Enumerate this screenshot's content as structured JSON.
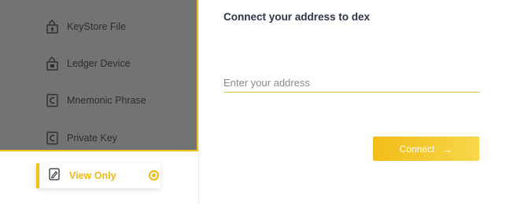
{
  "sidebar": {
    "items": [
      {
        "label": "KeyStore File",
        "icon": "keystore-file-icon"
      },
      {
        "label": "Ledger Device",
        "icon": "ledger-device-icon"
      },
      {
        "label": "Mnemonic Phrase",
        "icon": "mnemonic-phrase-icon"
      },
      {
        "label": "Private Key",
        "icon": "private-key-icon"
      }
    ],
    "selected": {
      "label": "View Only",
      "icon": "view-only-icon"
    }
  },
  "main": {
    "title": "Connect your address to dex",
    "address_input": {
      "placeholder": "Enter your address",
      "value": ""
    },
    "connect_button": {
      "label": "Connect",
      "arrow": "→"
    }
  },
  "colors": {
    "accent": "#f0b90b",
    "overlay": "#737373",
    "title": "#2f3547"
  }
}
